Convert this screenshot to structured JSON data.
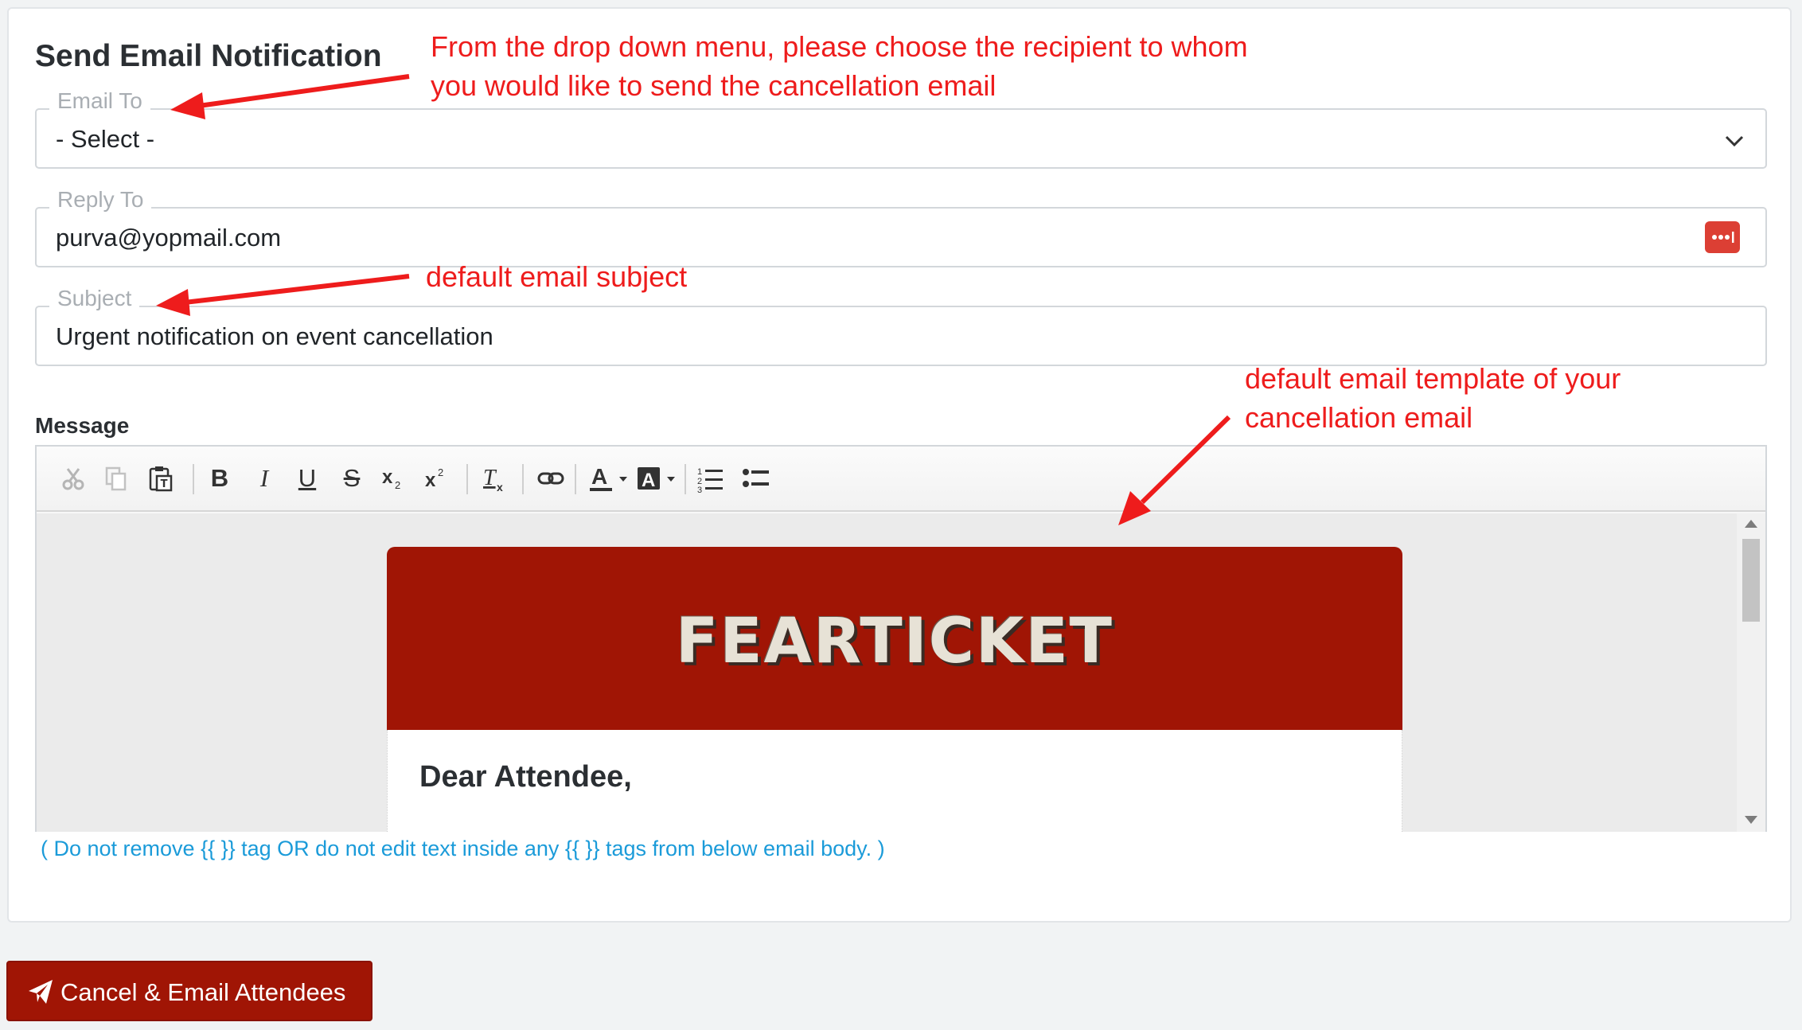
{
  "form": {
    "title": "Send Email Notification",
    "email_to": {
      "label": "Email To",
      "value": "- Select -"
    },
    "reply_to": {
      "label": "Reply To",
      "value": "purva@yopmail.com"
    },
    "subject": {
      "label": "Subject",
      "value": "Urgent notification on event cancellation"
    },
    "message_label": "Message"
  },
  "editor": {
    "toolbar": [
      "cut-icon",
      "copy-icon",
      "paste-text-icon",
      "bold-icon",
      "italic-icon",
      "underline-icon",
      "strikethrough-icon",
      "subscript-icon",
      "superscript-icon",
      "remove-format-icon",
      "link-icon",
      "text-color-icon",
      "background-color-icon",
      "numbered-list-icon",
      "bulleted-list-icon"
    ],
    "toolbar_letters": {
      "bold": "B",
      "italic": "I",
      "underline": "U",
      "strike": "S"
    },
    "email": {
      "logo_text": "FEARTICKET",
      "greeting": "Dear Attendee,",
      "banner_color": "#a01505"
    }
  },
  "note": "( Do not remove {{ }} tag OR do not edit text inside any {{ }} tags from below email body. )",
  "cta_button": "Cancel & Email Attendees",
  "annotations": {
    "email_to_1": "From the drop down menu, please choose the recipient to whom",
    "email_to_2": "you would like to send the cancellation email",
    "subject": "default email subject",
    "template_1": "default email template of your",
    "template_2": "cancellation email"
  },
  "colors": {
    "accent": "#a01505",
    "annotation": "#ee1c1c",
    "note": "#1b9bd9"
  }
}
